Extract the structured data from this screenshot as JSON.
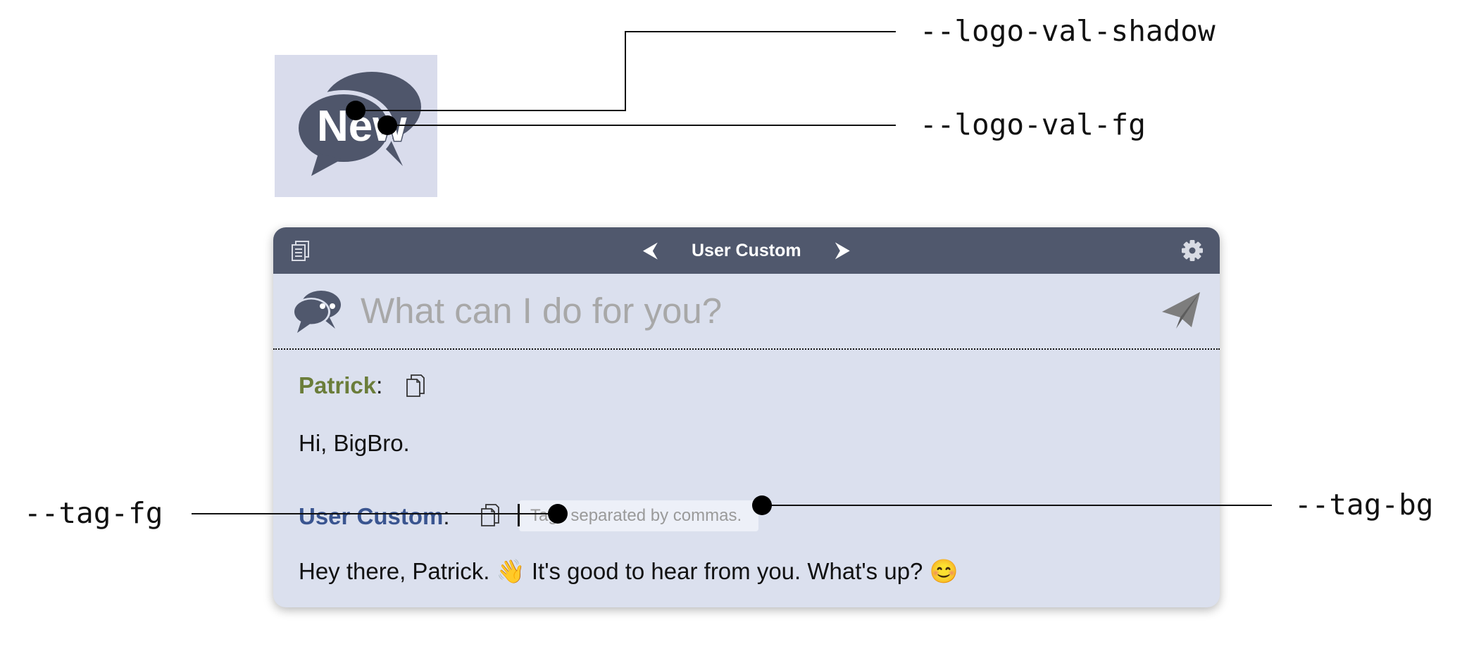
{
  "annotations": {
    "logo_shadow": "--logo-val-shadow",
    "logo_fg": "--logo-val-fg",
    "tag_fg": "--tag-fg",
    "tag_bg": "--tag-bg"
  },
  "logo": {
    "text": "New",
    "icon": "chat-bubbles-icon"
  },
  "panel": {
    "title": "User Custom",
    "prev_label": "⮜",
    "next_label": "⮞",
    "icons": {
      "left": "document-copy-icon",
      "right": "gear-icon",
      "bot": "chat-bubbles-icon",
      "send": "paper-plane-icon"
    },
    "input": {
      "placeholder": "What can I do for you?",
      "value": ""
    }
  },
  "messages": [
    {
      "sender": "Patrick",
      "colon": ":",
      "text": "Hi, BigBro.",
      "name_color": "#6b7d3a"
    },
    {
      "sender": "User Custom",
      "colon": ":",
      "text": "Hey there, Patrick. 👋 It's good to hear from you. What's up? 😊",
      "name_color": "#3a5590",
      "tag_placeholder": "Tags separated by commas."
    }
  ],
  "colors": {
    "titlebar_bg": "#50586d",
    "panel_bg": "#dbe0ee",
    "logo_bg": "#d9dcec",
    "logo_fg": "#ffffff",
    "logo_shadow": "#4f566b"
  }
}
